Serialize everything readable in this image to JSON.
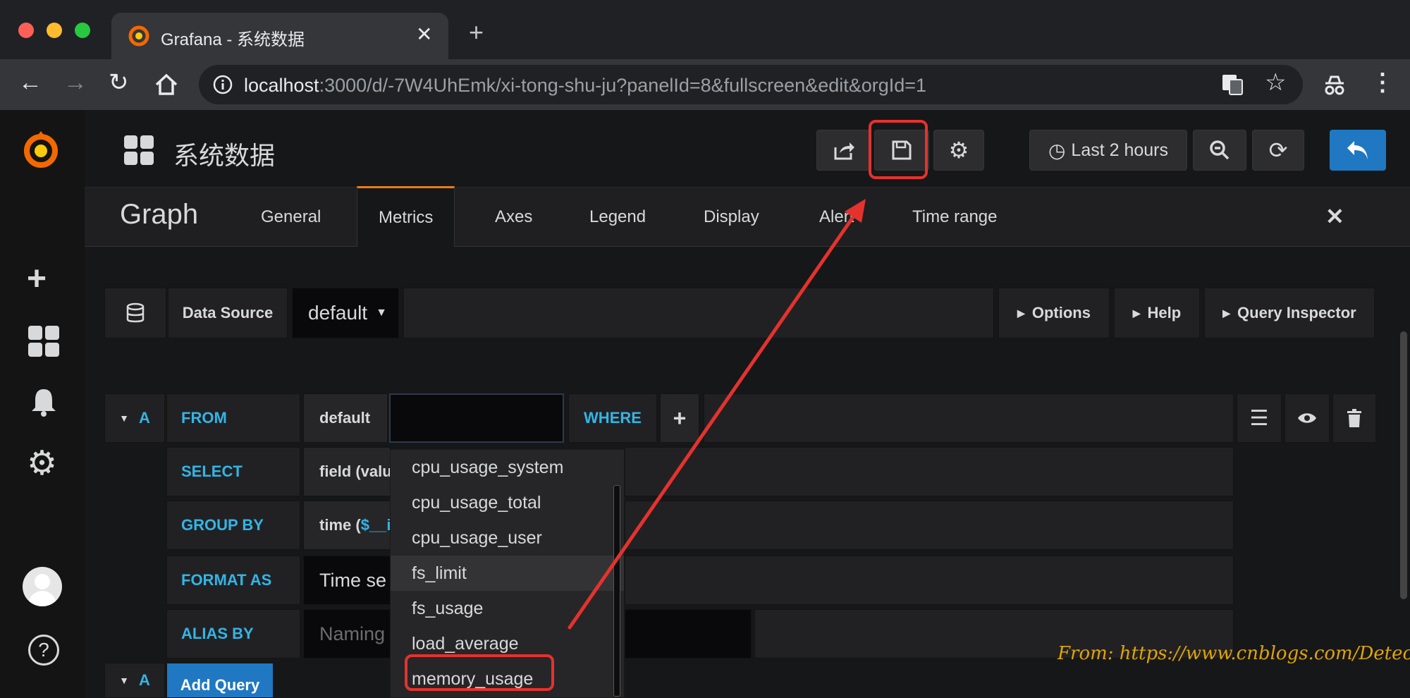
{
  "browser": {
    "tab_title": "Grafana - 系统数据",
    "close_glyph": "✕",
    "new_tab_glyph": "+",
    "url_host": "localhost",
    "url_rest": ":3000/d/-7W4UhEmk/xi-tong-shu-ju?panelId=8&fullscreen&edit&orgId=1"
  },
  "dashboard": {
    "title": "系统数据",
    "time_range": "Last 2 hours"
  },
  "panel": {
    "type_title": "Graph",
    "tabs": [
      "General",
      "Metrics",
      "Axes",
      "Legend",
      "Display",
      "Alert",
      "Time range"
    ],
    "close_glyph": "✕"
  },
  "datasource": {
    "label": "Data Source",
    "value": "default",
    "options_label": "Options",
    "help_label": "Help",
    "inspector_label": "Query Inspector"
  },
  "query": {
    "ref": "A",
    "from_kw": "FROM",
    "from_db": "default",
    "where_kw": "WHERE",
    "select_kw": "SELECT",
    "select_val": "field (valu",
    "groupby_kw": "GROUP BY",
    "groupby_val_a": "time (",
    "groupby_val_b": "$__i",
    "format_kw": "FORMAT AS",
    "format_val": "Time se",
    "alias_kw": "ALIAS BY",
    "alias_placeholder": "Naming",
    "add_ref": "A",
    "add_query": "Add Query"
  },
  "measurements": [
    "cpu_usage_system",
    "cpu_usage_total",
    "cpu_usage_user",
    "fs_limit",
    "fs_usage",
    "load_average",
    "memory_usage"
  ],
  "watermark": "From: https://www.cnblogs.com/Detector/",
  "colors": {
    "accent_blue": "#33b5e5",
    "highlight_red": "#e5322d",
    "grafana_orange": "#eb7b18",
    "back_button": "#1f78c1"
  }
}
